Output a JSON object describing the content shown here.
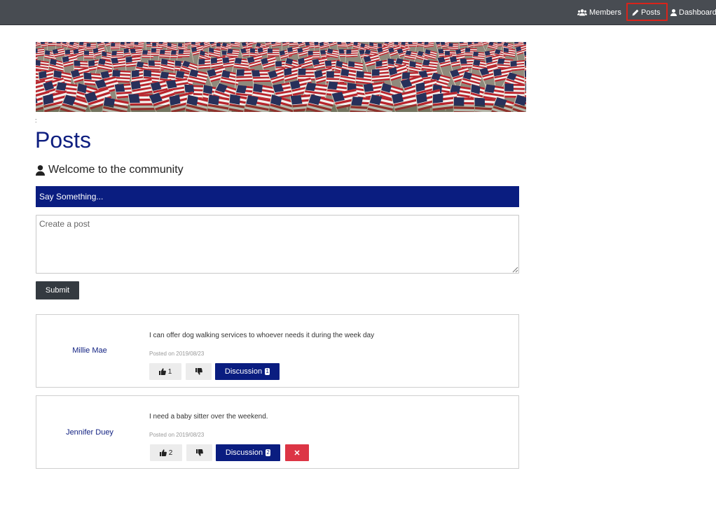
{
  "nav": {
    "items": [
      {
        "label": "Members",
        "icon": "users-icon"
      },
      {
        "label": "Posts",
        "icon": "pencil-icon",
        "active": true
      },
      {
        "label": "Dashboard",
        "icon": "user-icon"
      }
    ],
    "highlight_color": "#d9241b"
  },
  "banner": {
    "description_icon": "american-flags-banner"
  },
  "page": {
    "tiny_mark": ":",
    "title": "Posts",
    "welcome": "Welcome to the community"
  },
  "composer": {
    "header": "Say Something...",
    "placeholder": "Create a post",
    "value": "",
    "submit_label": "Submit"
  },
  "posts": [
    {
      "author": "Millie Mae",
      "text": "I can offer dog walking services to whoever needs it during the week day",
      "posted_on": "Posted on 2019/08/23",
      "likes": "1",
      "discussion_label": "Discussion",
      "discussion_count": "1",
      "can_delete": false
    },
    {
      "author": "Jennifer Duey",
      "text": "I need a baby sitter over the weekend.",
      "posted_on": "Posted on 2019/08/23",
      "likes": "2",
      "discussion_label": "Discussion",
      "discussion_count": "2",
      "can_delete": true,
      "delete_label": "✕"
    }
  ],
  "colors": {
    "nav_bg": "#484c52",
    "accent": "#0a1d80",
    "submit_bg": "#343a40",
    "danger": "#dc3545"
  }
}
